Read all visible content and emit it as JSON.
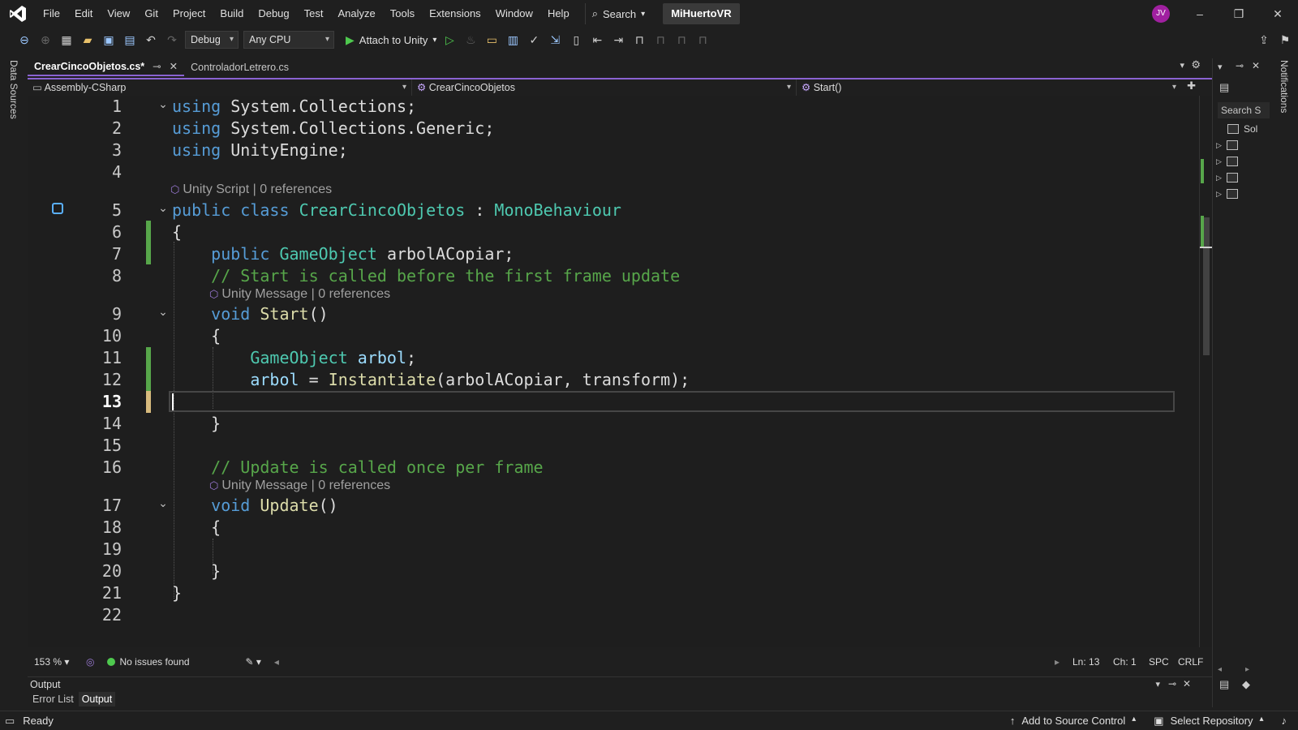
{
  "menu": {
    "items": [
      "File",
      "Edit",
      "View",
      "Git",
      "Project",
      "Build",
      "Debug",
      "Test",
      "Analyze",
      "Tools",
      "Extensions",
      "Window",
      "Help"
    ],
    "search_label": "Search",
    "project_name": "MiHuertoVR",
    "avatar_initials": "JV"
  },
  "toolbar": {
    "config": "Debug",
    "platform": "Any CPU",
    "attach_label": "Attach to Unity"
  },
  "left_strip": {
    "label": "Data Sources"
  },
  "tabs": [
    {
      "label": "CrearCincoObjetos.cs*"
    },
    {
      "label": "ControladorLetrero.cs"
    }
  ],
  "navbar": {
    "project": "Assembly-CSharp",
    "class": "CrearCincoObjetos",
    "member": "Start()"
  },
  "code": {
    "line_numbers": [
      "1",
      "2",
      "3",
      "4",
      "5",
      "6",
      "7",
      "8",
      "9",
      "10",
      "11",
      "12",
      "13",
      "14",
      "15",
      "16",
      "17",
      "18",
      "19",
      "20",
      "21",
      "22"
    ],
    "current_line": "13",
    "lines": {
      "l1": [
        "using",
        "System.Collections;"
      ],
      "l2": [
        "using",
        "System.Collections.Generic;"
      ],
      "l3": [
        "using",
        "UnityEngine;"
      ],
      "l5": [
        "public",
        "class",
        "CrearCincoObjetos",
        ":",
        "MonoBehaviour"
      ],
      "l6": "{",
      "l7": [
        "public",
        "GameObject",
        "arbolACopiar;"
      ],
      "l8": "// Start is called before the first frame update",
      "l9": [
        "void",
        "Start",
        "()"
      ],
      "l10": "{",
      "l11": [
        "GameObject",
        "arbol",
        ";"
      ],
      "l12": [
        "arbol",
        "=",
        "Instantiate",
        "(arbolACopiar, transform);"
      ],
      "l14": "}",
      "l16": "// Update is called once per frame",
      "l17": [
        "void",
        "Update",
        "()"
      ],
      "l18": "{",
      "l20": "}",
      "l21": "}"
    },
    "codelens": {
      "class": "Unity Script | 0 references",
      "start": "Unity Message | 0 references",
      "update": "Unity Message | 0 references"
    }
  },
  "editor_status": {
    "zoom": "153 %",
    "issues": "No issues found",
    "ln": "Ln: 13",
    "ch": "Ch: 1",
    "spc": "SPC",
    "eol": "CRLF"
  },
  "output_panel": {
    "title": "Output",
    "tabs": [
      "Error List",
      "Output"
    ]
  },
  "right_panel": {
    "search_placeholder": "Search S",
    "solution_label": "Sol"
  },
  "notifications": {
    "label": "Notifications"
  },
  "statusbar": {
    "ready": "Ready",
    "source_control": "Add to Source Control",
    "repository": "Select Repository"
  },
  "colors": {
    "keyword": "#569cd6",
    "type": "#4ec9b0",
    "method": "#dcdcaa",
    "comment": "#57a64a",
    "accent": "#8a63d2"
  }
}
